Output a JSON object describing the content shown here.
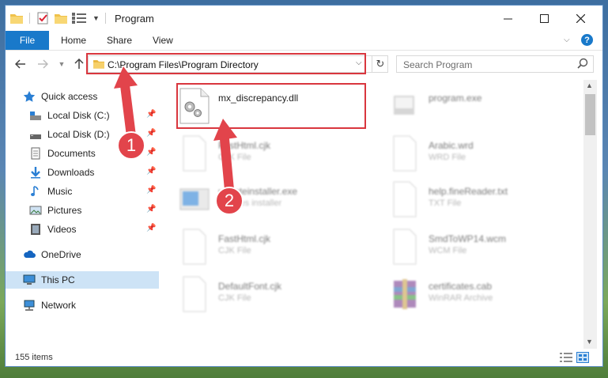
{
  "window": {
    "title": "Program"
  },
  "ribbon": {
    "file": "File",
    "home": "Home",
    "share": "Share",
    "view": "View"
  },
  "address": {
    "path": "C:\\Program Files\\Program Directory"
  },
  "search": {
    "placeholder": "Search Program"
  },
  "sidebar": {
    "items": [
      {
        "label": "Quick access",
        "icon": "star-icon",
        "pinned": false
      },
      {
        "label": "Local Disk (C:)",
        "icon": "drive-icon",
        "pinned": true
      },
      {
        "label": "Local Disk (D:)",
        "icon": "drive-icon",
        "pinned": true
      },
      {
        "label": "Documents",
        "icon": "documents-icon",
        "pinned": true
      },
      {
        "label": "Downloads",
        "icon": "downloads-icon",
        "pinned": true
      },
      {
        "label": "Music",
        "icon": "music-icon",
        "pinned": true
      },
      {
        "label": "Pictures",
        "icon": "pictures-icon",
        "pinned": true
      },
      {
        "label": "Videos",
        "icon": "videos-icon",
        "pinned": true
      },
      {
        "label": "OneDrive",
        "icon": "cloud-icon",
        "pinned": false
      },
      {
        "label": "This PC",
        "icon": "computer-icon",
        "pinned": false,
        "selected": true
      },
      {
        "label": "Network",
        "icon": "network-icon",
        "pinned": false
      }
    ]
  },
  "files": [
    {
      "name": "mx_discrepancy.dll",
      "sub": "",
      "icon": "dll-gear-icon",
      "blurred": false
    },
    {
      "name": "program.exe",
      "sub": "",
      "icon": "exe-icon",
      "blurred": true
    },
    {
      "name": "FastHtml.cjk",
      "sub": "CJK File",
      "icon": "blank-file-icon",
      "blurred": true
    },
    {
      "name": "Arabic.wrd",
      "sub": "WRD File",
      "icon": "blank-file-icon",
      "blurred": true
    },
    {
      "name": "updateinstaller.exe",
      "sub": "updates installer",
      "icon": "installer-icon",
      "blurred": true
    },
    {
      "name": "help.fineReader.txt",
      "sub": "TXT File",
      "icon": "blank-file-icon",
      "blurred": true
    },
    {
      "name": "FastHtml.cjk",
      "sub": "CJK File",
      "icon": "blank-file-icon",
      "blurred": true
    },
    {
      "name": "SmdToWP14.wcm",
      "sub": "WCM File",
      "icon": "blank-file-icon",
      "blurred": true
    },
    {
      "name": "DefaultFont.cjk",
      "sub": "CJK File",
      "icon": "blank-file-icon",
      "blurred": true
    },
    {
      "name": "certificates.cab",
      "sub": "WinRAR Archive",
      "icon": "winrar-icon",
      "blurred": true
    }
  ],
  "status": {
    "count": "155 items"
  },
  "callouts": {
    "one": "1",
    "two": "2"
  },
  "colors": {
    "accent": "#1979ca",
    "highlight": "#d9363e",
    "selected": "#cde3f6"
  }
}
